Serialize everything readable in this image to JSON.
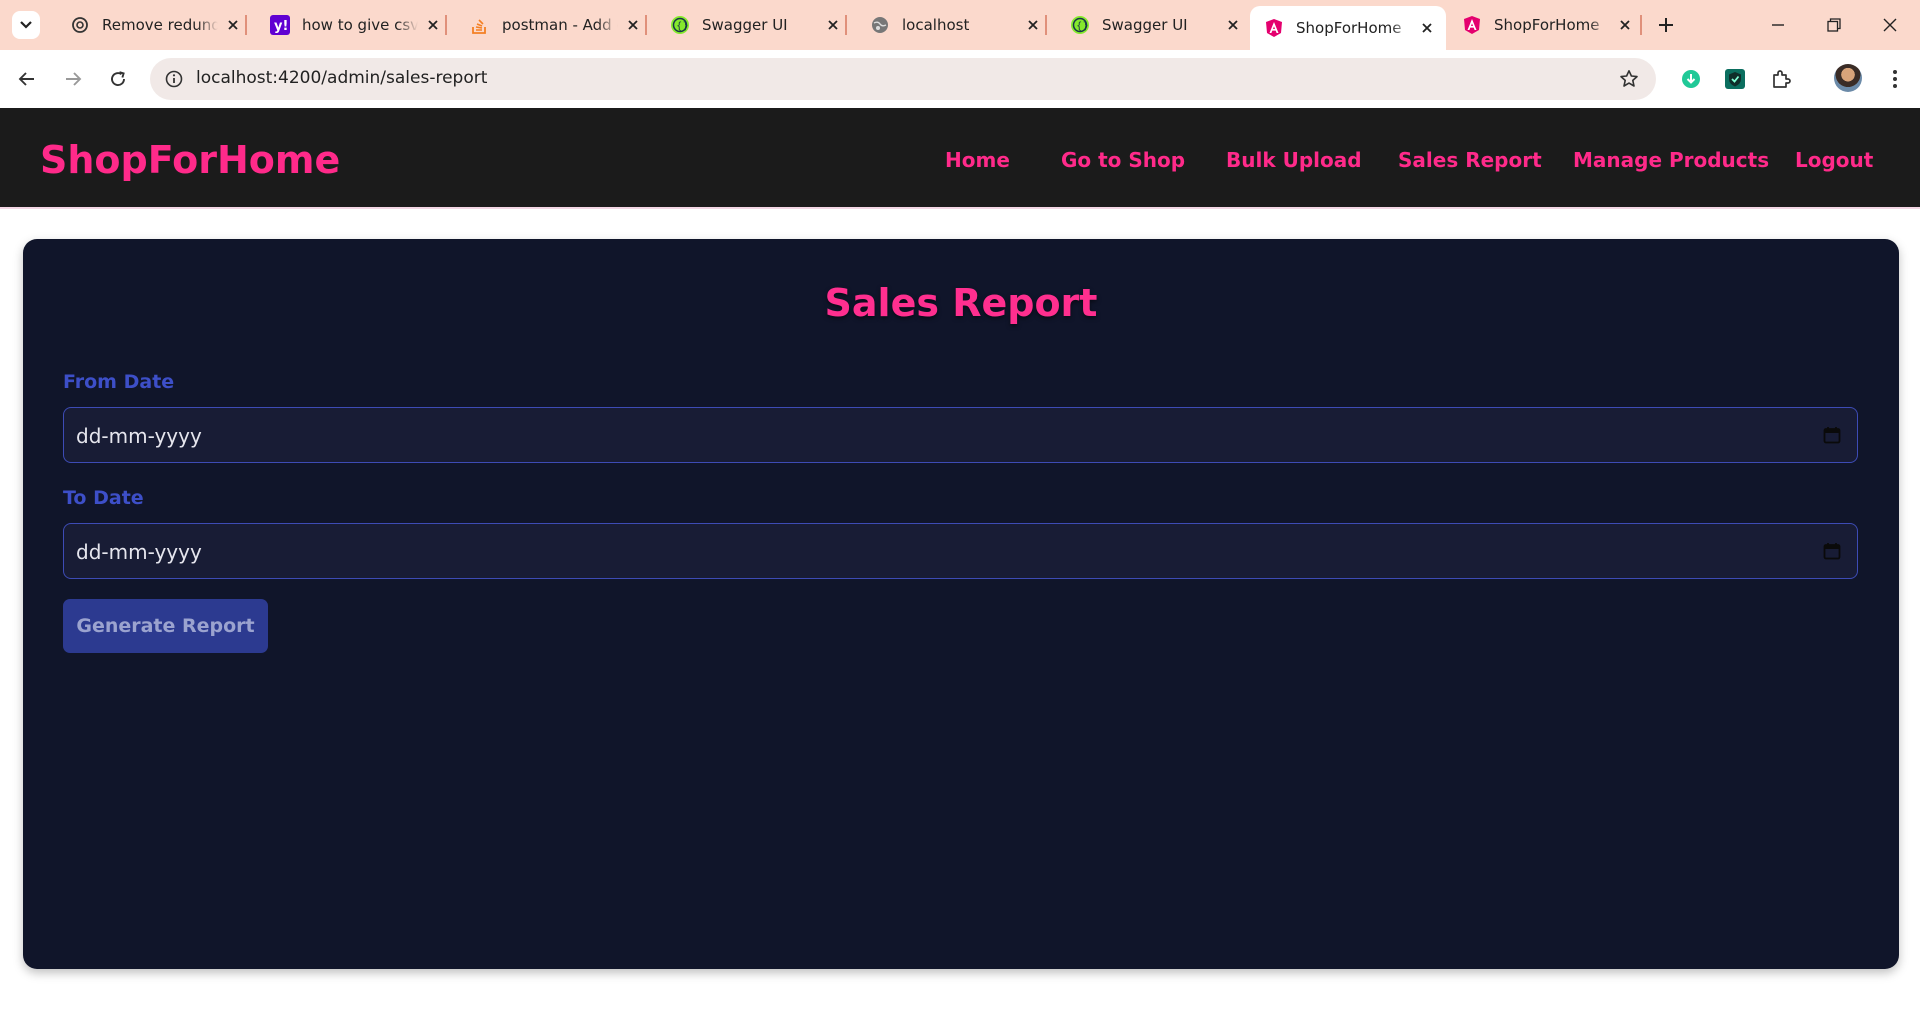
{
  "browser": {
    "tabs": [
      {
        "title": "Remove redundant",
        "icon": "openai-icon"
      },
      {
        "title": "how to give csv f",
        "icon": "yahoo-icon"
      },
      {
        "title": "postman - Add c",
        "icon": "stackoverflow-icon"
      },
      {
        "title": "Swagger UI",
        "icon": "swagger-icon"
      },
      {
        "title": "localhost",
        "icon": "globe-icon"
      },
      {
        "title": "Swagger UI",
        "icon": "swagger-icon"
      },
      {
        "title": "ShopForHome",
        "icon": "angular-icon",
        "active": true
      },
      {
        "title": "ShopForHome",
        "icon": "angular-icon"
      }
    ],
    "url": "localhost:4200/admin/sales-report"
  },
  "header": {
    "brand": "ShopForHome",
    "nav": [
      "Home",
      "Go to Shop",
      "Bulk Upload",
      "Sales Report",
      "Manage Products",
      "Logout"
    ]
  },
  "report": {
    "title": "Sales Report",
    "from_label": "From Date",
    "from_value": "dd-mm-yyyy",
    "to_label": "To Date",
    "to_value": "dd-mm-yyyy",
    "button": "Generate Report"
  },
  "colors": {
    "accent": "#ff2a8a",
    "header_bg": "#1b1b1b",
    "panel_bg": "#10152a",
    "label": "#3d4fc8",
    "button_bg": "#2c3a90"
  }
}
